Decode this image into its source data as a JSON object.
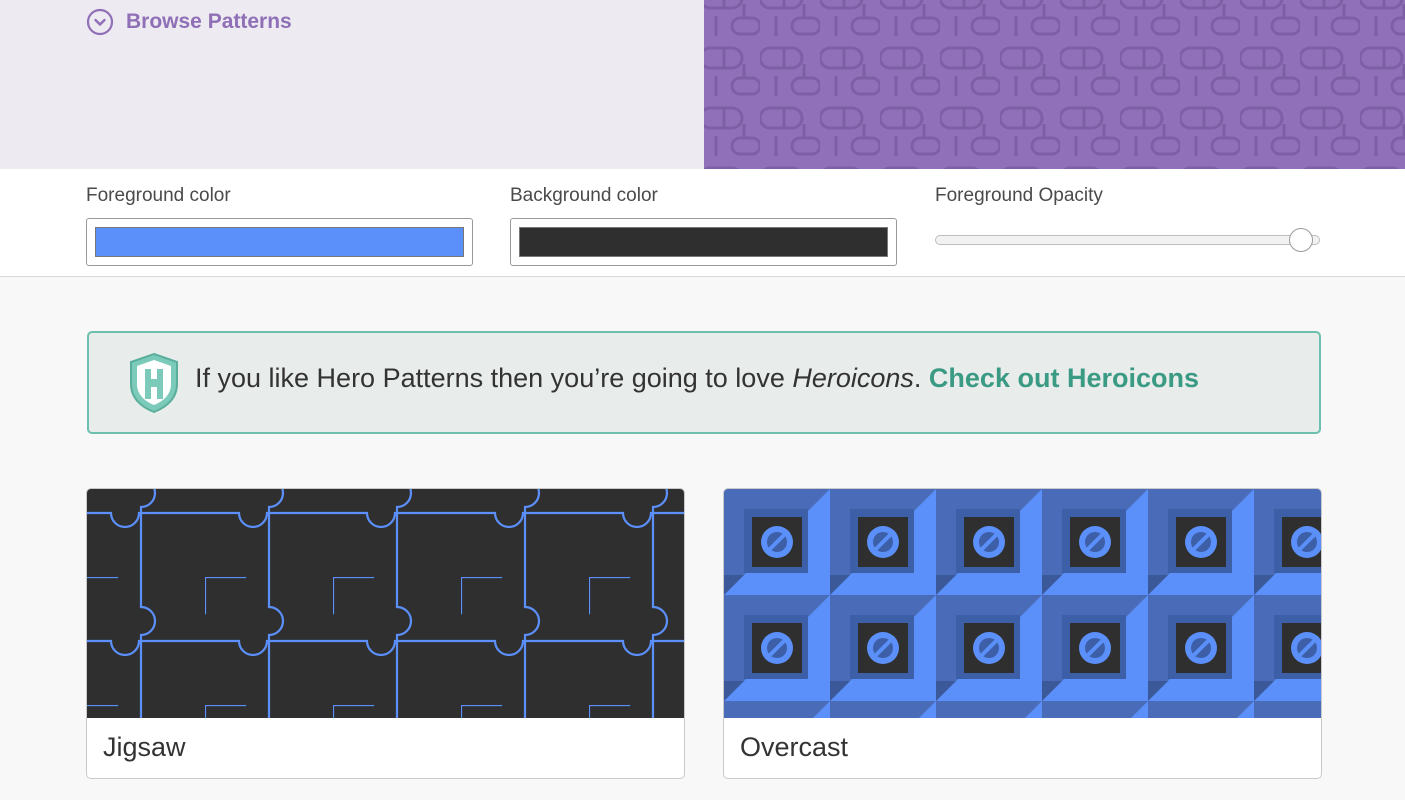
{
  "header": {
    "browse_label": "Browse Patterns",
    "accent_color": "#8f6fb6",
    "hero_bg_color": "#9070b8",
    "icons": {
      "browse": "chevron-down-circle-icon"
    }
  },
  "controls": {
    "foreground": {
      "label": "Foreground color",
      "value": "#5b8ff9"
    },
    "background": {
      "label": "Background color",
      "value": "#2f2f2f"
    },
    "opacity": {
      "label": "Foreground Opacity",
      "value": 0.95
    }
  },
  "promo": {
    "text_before": "If you like Hero Patterns then you’re going to love ",
    "product": "Heroicons",
    "text_after": ". ",
    "link_text": "Check out Heroicons",
    "accent_color": "#3a9a83",
    "border_color": "#6cc0ad",
    "icon": "heroicons-shield-logo"
  },
  "patterns": [
    {
      "name": "Jigsaw",
      "icon": "jigsaw-pattern"
    },
    {
      "name": "Overcast",
      "icon": "overcast-pattern"
    }
  ]
}
